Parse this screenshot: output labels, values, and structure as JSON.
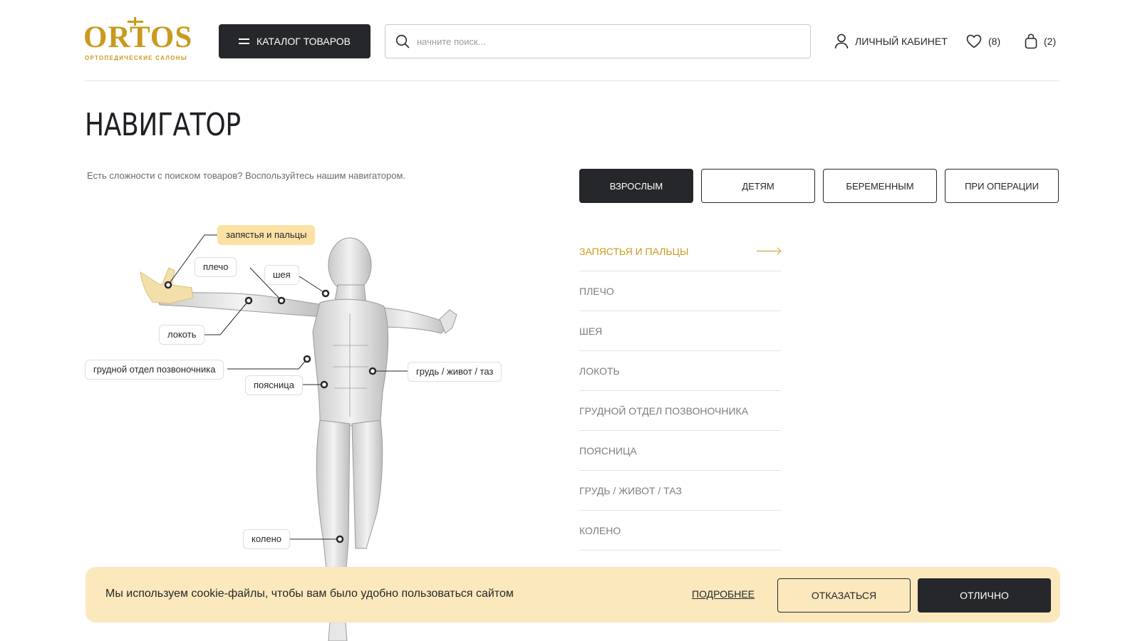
{
  "brand": {
    "name": "ORTOS",
    "tagline": "ОРТОПЕДИЧЕСКИЕ САЛОНЫ",
    "color": "#c99a1d"
  },
  "header": {
    "catalog_label": "КАТАЛОГ ТОВАРОВ",
    "search_placeholder": "начните поиск...",
    "account_label": "ЛИЧНЫЙ КАБИНЕТ",
    "favorites_count": "(8)",
    "cart_count": "(2)"
  },
  "page": {
    "title": "НАВИГАТОР",
    "intro": "Есть сложности с поиском товаров? Воспользуйтесь нашим навигатором."
  },
  "tabs": [
    {
      "label": "ВЗРОСЛЫМ",
      "active": true
    },
    {
      "label": "ДЕТЯМ",
      "active": false
    },
    {
      "label": "БЕРЕМЕННЫМ",
      "active": false
    },
    {
      "label": "ПРИ ОПЕРАЦИИ",
      "active": false
    }
  ],
  "body_tags": {
    "wrist": "запястья и пальцы",
    "shoulder": "плечо",
    "neck": "шея",
    "elbow": "локоть",
    "thoracic": "грудной отдел позвоночника",
    "lumbar": "поясница",
    "chest": "грудь / живот / таз",
    "knee": "колено"
  },
  "zones": [
    {
      "label": "ЗАПЯСТЬЯ И ПАЛЬЦЫ",
      "active": true
    },
    {
      "label": "ПЛЕЧО",
      "active": false
    },
    {
      "label": "ШЕЯ",
      "active": false
    },
    {
      "label": "ЛОКОТЬ",
      "active": false
    },
    {
      "label": "ГРУДНОЙ ОТДЕЛ ПОЗВОНОЧНИКА",
      "active": false
    },
    {
      "label": "ПОЯСНИЦА",
      "active": false
    },
    {
      "label": "ГРУДЬ / ЖИВОТ / ТАЗ",
      "active": false
    },
    {
      "label": "КОЛЕНО",
      "active": false
    }
  ],
  "cookie": {
    "text": "Мы используем cookie-файлы, чтобы вам было удобно пользоваться сайтом",
    "more_label": "ПОДРОБНЕЕ",
    "decline_label": "ОТКАЗАТЬСЯ",
    "accept_label": "ОТЛИЧНО"
  },
  "colors": {
    "accent": "#c99a1d",
    "dark": "#26272b",
    "highlight": "#fbe1a4",
    "cookie_bg": "#fbe9bd"
  }
}
